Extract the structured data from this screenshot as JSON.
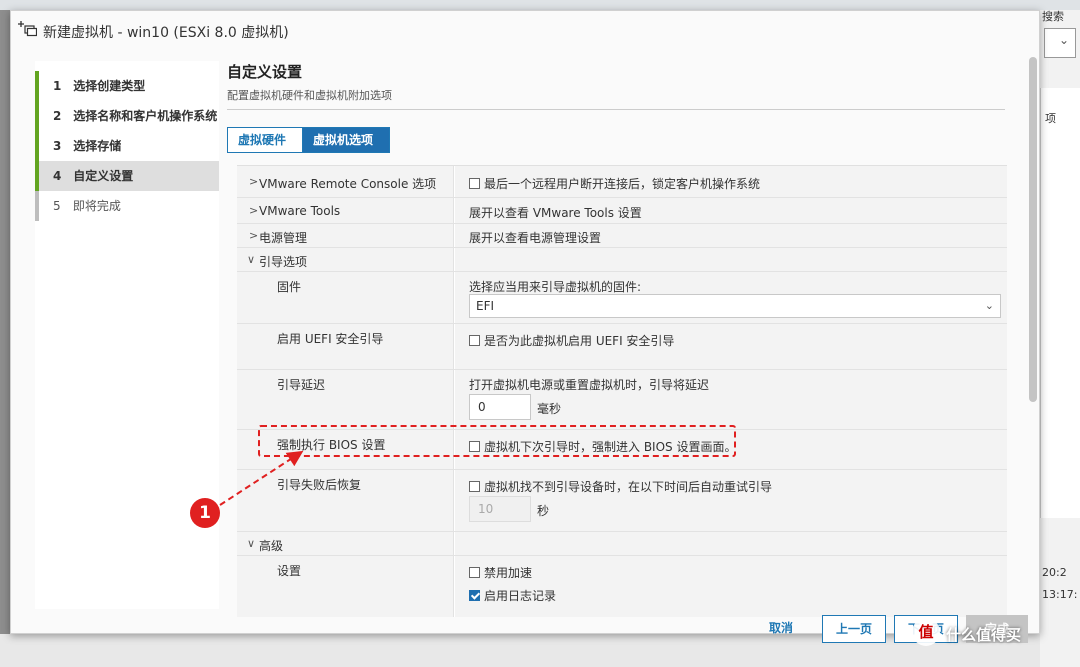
{
  "window": {
    "title": "新建虚拟机 - win10 (ESXi 8.0 虚拟机)"
  },
  "background": {
    "right_label_top": "搜索",
    "right_label_mid": "项",
    "right_time_1": "20:2",
    "right_time_2": "13:17:"
  },
  "steps": [
    {
      "num": "1",
      "label": "选择创建类型",
      "state": "done"
    },
    {
      "num": "2",
      "label": "选择名称和客户机操作系统",
      "state": "done"
    },
    {
      "num": "3",
      "label": "选择存储",
      "state": "done"
    },
    {
      "num": "4",
      "label": "自定义设置",
      "state": "active"
    },
    {
      "num": "5",
      "label": "即将完成",
      "state": "todo"
    }
  ],
  "main": {
    "title": "自定义设置",
    "subtitle": "配置虚拟机硬件和虚拟机附加选项",
    "tabs": [
      {
        "label": "虚拟硬件",
        "active": false
      },
      {
        "label": "虚拟机选项",
        "active": true
      }
    ]
  },
  "options": {
    "vmrc": {
      "label": "VMware Remote Console 选项",
      "checkbox": "最后一个远程用户断开连接后，锁定客户机操作系统",
      "checked": false
    },
    "tools": {
      "label": "VMware Tools",
      "value": "展开以查看 VMware Tools 设置"
    },
    "power": {
      "label": "电源管理",
      "value": "展开以查看电源管理设置"
    },
    "boot": {
      "label": "引导选项"
    },
    "firmware": {
      "label": "固件",
      "hint": "选择应当用来引导虚拟机的固件:",
      "selected": "EFI"
    },
    "secureboot": {
      "label": "启用 UEFI 安全引导",
      "checkbox": "是否为此虚拟机启用 UEFI 安全引导",
      "checked": false
    },
    "bootdelay": {
      "label": "引导延迟",
      "hint": "打开虚拟机电源或重置虚拟机时，引导将延迟",
      "value": "0",
      "unit": "毫秒"
    },
    "forcebios": {
      "label": "强制执行 BIOS 设置",
      "checkbox": "虚拟机下次引导时，强制进入 BIOS 设置画面。",
      "checked": false
    },
    "bootretry": {
      "label": "引导失败后恢复",
      "checkbox": "虚拟机找不到引导设备时，在以下时间后自动重试引导",
      "checked": false,
      "value": "10",
      "unit": "秒"
    },
    "advanced": {
      "label": "高级"
    },
    "settings": {
      "label": "设置",
      "disable_accel": "禁用加速",
      "disable_accel_checked": false,
      "enable_logging": "启用日志记录",
      "enable_logging_checked": true
    }
  },
  "footer": {
    "cancel": "取消",
    "prev": "上一页",
    "next": "下一页",
    "finish": "完成"
  },
  "annotation": {
    "badge": "1",
    "color": "#e02020"
  },
  "watermark": {
    "icon": "值",
    "text": "什么值得买"
  },
  "colors": {
    "accent": "#1f6fb0",
    "step_done": "#62a420",
    "highlight": "#e02020"
  }
}
